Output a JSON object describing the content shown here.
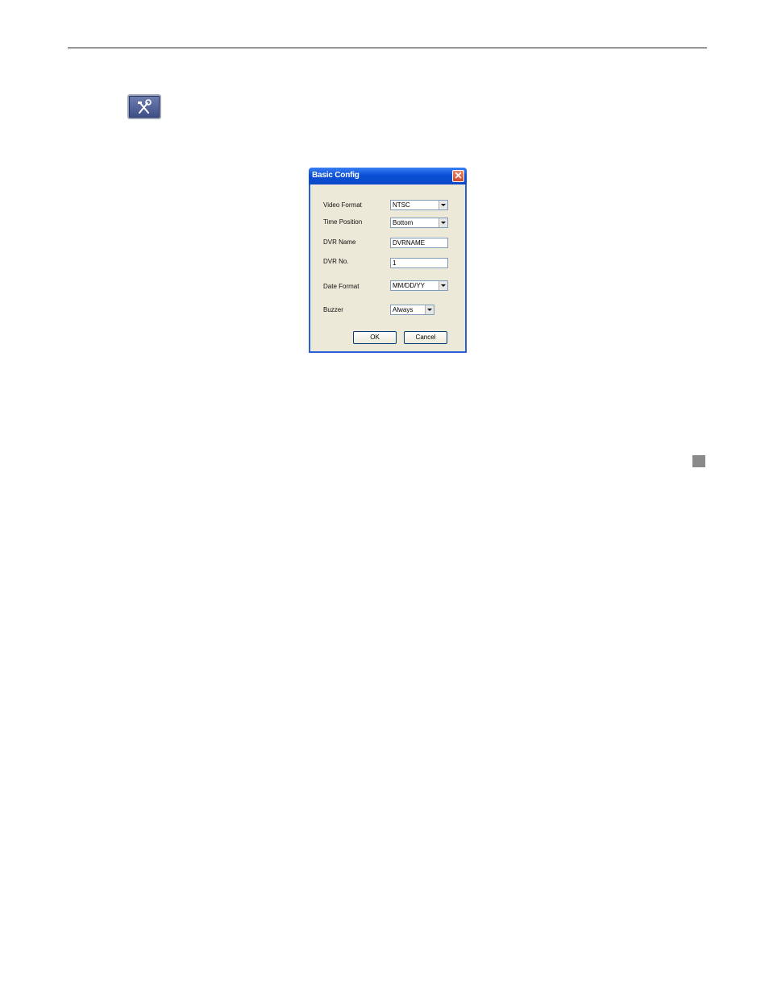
{
  "dialog": {
    "title": "Basic Config",
    "close_glyph": "✕",
    "fields": {
      "video_format": {
        "label": "Video Format",
        "value": "NTSC"
      },
      "time_position": {
        "label": "Time Position",
        "value": "Bottom"
      },
      "dvr_name": {
        "label": "DVR Name",
        "value": "DVRNAME"
      },
      "dvr_no": {
        "label": "DVR No.",
        "value": "1"
      },
      "date_format": {
        "label": "Date Format",
        "value": "MM/DD/YY"
      },
      "buzzer": {
        "label": "Buzzer",
        "value": "Always"
      }
    },
    "ok_label": "OK",
    "cancel_label": "Cancel"
  },
  "icons": {
    "tools_button": "tools-icon",
    "section_marker": "square-marker"
  },
  "colors": {
    "titlebar": "#0a4fd6",
    "dialog_bg": "#ece9d8",
    "close_button": "#d0482a",
    "tools_button": "#4a5a94",
    "section_marker": "#8a8a8a"
  }
}
